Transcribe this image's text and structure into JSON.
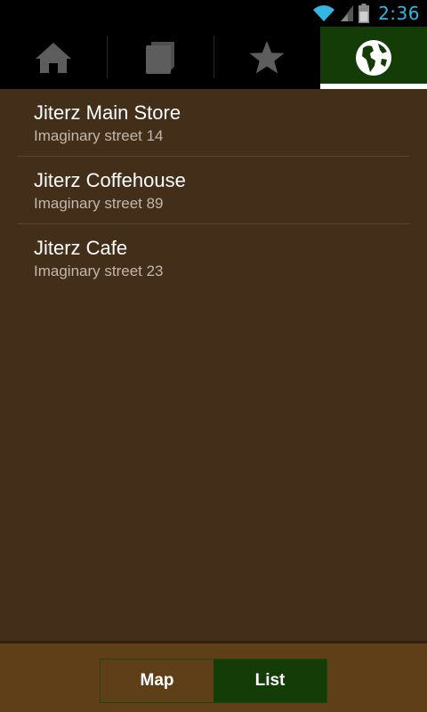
{
  "status_bar": {
    "time": "2:36",
    "icons": [
      "wifi-icon",
      "signal-icon",
      "battery-icon"
    ],
    "clock_color": "#33b5e5"
  },
  "tabs": [
    {
      "icon": "home-icon",
      "active": false
    },
    {
      "icon": "book-icon",
      "active": false
    },
    {
      "icon": "star-icon",
      "active": false
    },
    {
      "icon": "globe-icon",
      "active": true
    }
  ],
  "locations": [
    {
      "name": "Jiterz Main Store",
      "address": "Imaginary street 14"
    },
    {
      "name": "Jiterz Coffehouse",
      "address": "Imaginary street 89"
    },
    {
      "name": "Jiterz Cafe",
      "address": "Imaginary street 23"
    }
  ],
  "view_toggle": {
    "map_label": "Map",
    "list_label": "List",
    "selected": "List"
  },
  "colors": {
    "background": "#432f19",
    "accent": "#143c07",
    "bottom_bar": "#5f3f17"
  }
}
